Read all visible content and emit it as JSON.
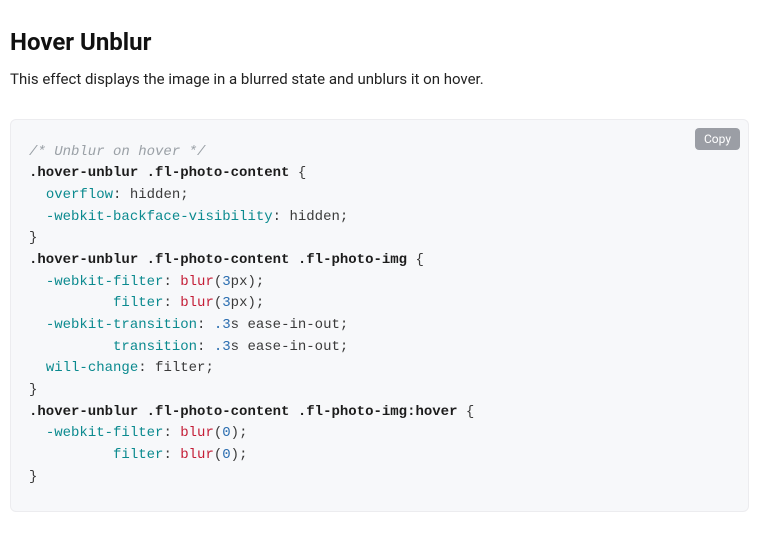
{
  "heading": "Hover Unblur",
  "description": "This effect displays the image in a blurred state and unblurs it on hover.",
  "copy_label": "Copy",
  "code": {
    "tokens": [
      {
        "t": "comment",
        "v": "/* Unblur on hover */"
      },
      {
        "t": "nl"
      },
      {
        "t": "sel",
        "v": ".hover-unblur"
      },
      {
        "t": "plain",
        "v": " "
      },
      {
        "t": "sel",
        "v": ".fl-photo-content"
      },
      {
        "t": "plain",
        "v": " "
      },
      {
        "t": "punc",
        "v": "{"
      },
      {
        "t": "nl"
      },
      {
        "t": "plain",
        "v": "  "
      },
      {
        "t": "prop",
        "v": "overflow"
      },
      {
        "t": "punc",
        "v": ": "
      },
      {
        "t": "plain",
        "v": "hidden"
      },
      {
        "t": "punc",
        "v": ";"
      },
      {
        "t": "nl"
      },
      {
        "t": "plain",
        "v": "  "
      },
      {
        "t": "prop",
        "v": "-webkit-backface-visibility"
      },
      {
        "t": "punc",
        "v": ": "
      },
      {
        "t": "plain",
        "v": "hidden"
      },
      {
        "t": "punc",
        "v": ";"
      },
      {
        "t": "nl"
      },
      {
        "t": "punc",
        "v": "}"
      },
      {
        "t": "nl"
      },
      {
        "t": "sel",
        "v": ".hover-unblur"
      },
      {
        "t": "plain",
        "v": " "
      },
      {
        "t": "sel",
        "v": ".fl-photo-content"
      },
      {
        "t": "plain",
        "v": " "
      },
      {
        "t": "sel",
        "v": ".fl-photo-img"
      },
      {
        "t": "plain",
        "v": " "
      },
      {
        "t": "punc",
        "v": "{"
      },
      {
        "t": "nl"
      },
      {
        "t": "plain",
        "v": "  "
      },
      {
        "t": "prop",
        "v": "-webkit-filter"
      },
      {
        "t": "punc",
        "v": ": "
      },
      {
        "t": "func",
        "v": "blur"
      },
      {
        "t": "punc",
        "v": "("
      },
      {
        "t": "num",
        "v": "3"
      },
      {
        "t": "plain",
        "v": "px"
      },
      {
        "t": "punc",
        "v": ")"
      },
      {
        "t": "punc",
        "v": ";"
      },
      {
        "t": "nl"
      },
      {
        "t": "plain",
        "v": "          "
      },
      {
        "t": "prop",
        "v": "filter"
      },
      {
        "t": "punc",
        "v": ": "
      },
      {
        "t": "func",
        "v": "blur"
      },
      {
        "t": "punc",
        "v": "("
      },
      {
        "t": "num",
        "v": "3"
      },
      {
        "t": "plain",
        "v": "px"
      },
      {
        "t": "punc",
        "v": ")"
      },
      {
        "t": "punc",
        "v": ";"
      },
      {
        "t": "nl"
      },
      {
        "t": "plain",
        "v": "  "
      },
      {
        "t": "prop",
        "v": "-webkit-transition"
      },
      {
        "t": "punc",
        "v": ": "
      },
      {
        "t": "num",
        "v": ".3"
      },
      {
        "t": "plain",
        "v": "s ease-in-out"
      },
      {
        "t": "punc",
        "v": ";"
      },
      {
        "t": "nl"
      },
      {
        "t": "plain",
        "v": "          "
      },
      {
        "t": "prop",
        "v": "transition"
      },
      {
        "t": "punc",
        "v": ": "
      },
      {
        "t": "num",
        "v": ".3"
      },
      {
        "t": "plain",
        "v": "s ease-in-out"
      },
      {
        "t": "punc",
        "v": ";"
      },
      {
        "t": "nl"
      },
      {
        "t": "plain",
        "v": "  "
      },
      {
        "t": "prop",
        "v": "will-change"
      },
      {
        "t": "punc",
        "v": ": "
      },
      {
        "t": "plain",
        "v": "filter"
      },
      {
        "t": "punc",
        "v": ";"
      },
      {
        "t": "nl"
      },
      {
        "t": "punc",
        "v": "}"
      },
      {
        "t": "nl"
      },
      {
        "t": "sel",
        "v": ".hover-unblur"
      },
      {
        "t": "plain",
        "v": " "
      },
      {
        "t": "sel",
        "v": ".fl-photo-content"
      },
      {
        "t": "plain",
        "v": " "
      },
      {
        "t": "sel",
        "v": ".fl-photo-img:hover"
      },
      {
        "t": "plain",
        "v": " "
      },
      {
        "t": "punc",
        "v": "{"
      },
      {
        "t": "nl"
      },
      {
        "t": "plain",
        "v": "  "
      },
      {
        "t": "prop",
        "v": "-webkit-filter"
      },
      {
        "t": "punc",
        "v": ": "
      },
      {
        "t": "func",
        "v": "blur"
      },
      {
        "t": "punc",
        "v": "("
      },
      {
        "t": "num",
        "v": "0"
      },
      {
        "t": "punc",
        "v": ")"
      },
      {
        "t": "punc",
        "v": ";"
      },
      {
        "t": "nl"
      },
      {
        "t": "plain",
        "v": "          "
      },
      {
        "t": "prop",
        "v": "filter"
      },
      {
        "t": "punc",
        "v": ": "
      },
      {
        "t": "func",
        "v": "blur"
      },
      {
        "t": "punc",
        "v": "("
      },
      {
        "t": "num",
        "v": "0"
      },
      {
        "t": "punc",
        "v": ")"
      },
      {
        "t": "punc",
        "v": ";"
      },
      {
        "t": "nl"
      },
      {
        "t": "punc",
        "v": "}"
      }
    ]
  }
}
